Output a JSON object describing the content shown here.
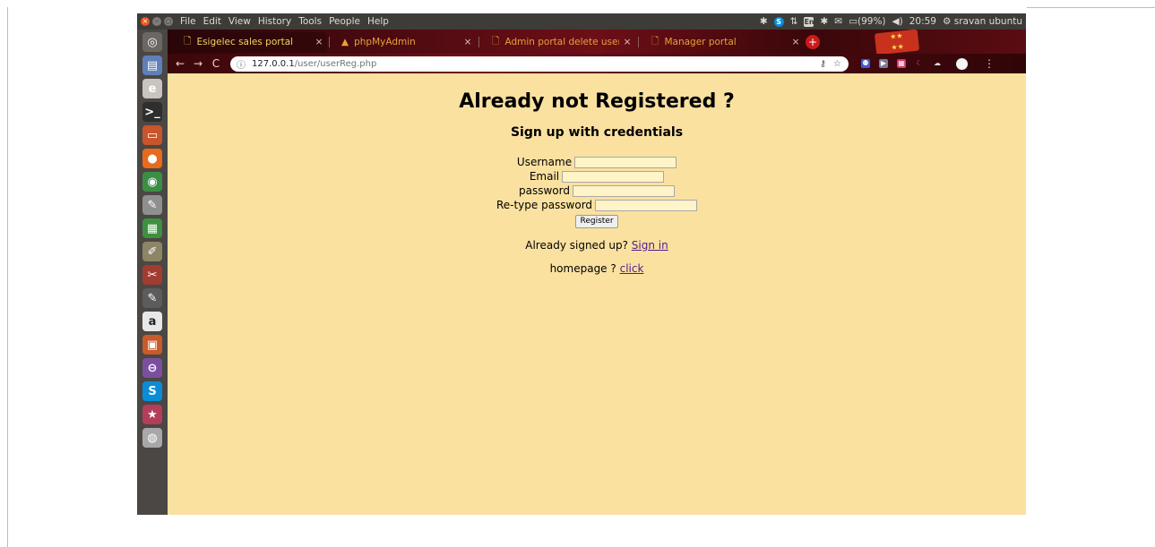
{
  "top_panel": {
    "menu": [
      "File",
      "Edit",
      "View",
      "History",
      "Tools",
      "People",
      "Help"
    ],
    "indicators": {
      "skype": "S",
      "keyboard_layout": "En",
      "battery": "(99%)",
      "time": "20:59",
      "user": "sravan ubuntu"
    }
  },
  "launcher": {
    "icons": [
      {
        "name": "dash-icon",
        "glyph": "◎",
        "color": "#6b6864"
      },
      {
        "name": "files-icon",
        "glyph": "▤",
        "color": "#5f7fb8"
      },
      {
        "name": "eclipse-icon",
        "glyph": "e",
        "color": "#c9c4be"
      },
      {
        "name": "terminal-icon",
        "glyph": ">_",
        "color": "#2e2e2e"
      },
      {
        "name": "archive-icon",
        "glyph": "▭",
        "color": "#c9552c"
      },
      {
        "name": "firefox-icon",
        "glyph": "●",
        "color": "#e86a1d"
      },
      {
        "name": "chrome-icon",
        "glyph": "◉",
        "color": "#3c8e45"
      },
      {
        "name": "text-editor-icon",
        "glyph": "✎",
        "color": "#8f8f8f"
      },
      {
        "name": "spreadsheet-icon",
        "glyph": "▦",
        "color": "#3d9140"
      },
      {
        "name": "draw-icon",
        "glyph": "✐",
        "color": "#8c8566"
      },
      {
        "name": "settings-tool-icon",
        "glyph": "✂",
        "color": "#a23c30"
      },
      {
        "name": "notes-icon",
        "glyph": "✎",
        "color": "#5c5c5c"
      },
      {
        "name": "amazon-icon",
        "glyph": "a",
        "color": "#e8e8e8"
      },
      {
        "name": "software-center-icon",
        "glyph": "▣",
        "color": "#c75b2a"
      },
      {
        "name": "disk-icon",
        "glyph": "⊖",
        "color": "#7b4fa0"
      },
      {
        "name": "skype-icon",
        "glyph": "S",
        "color": "#0a8dd6"
      },
      {
        "name": "starred-app-icon",
        "glyph": "★",
        "color": "#b33d5a"
      },
      {
        "name": "optical-drive-icon",
        "glyph": "◍",
        "color": "#a8a8a8"
      }
    ]
  },
  "tabs": [
    {
      "title": "Esigelec sales portal",
      "icon": "page-icon",
      "active": true
    },
    {
      "title": "phpMyAdmin",
      "icon": "phpmyadmin-icon",
      "active": false
    },
    {
      "title": "Admin portal delete users",
      "icon": "page-icon",
      "active": false
    },
    {
      "title": "Manager portal",
      "icon": "page-icon",
      "active": false
    }
  ],
  "toolbar": {
    "url_host": "127.0.0.1",
    "url_path": "/user/userReg.php"
  },
  "page": {
    "title": "Already not Registered ?",
    "subtitle": "Sign up with credentials",
    "fields": {
      "username_label": "Username",
      "email_label": "Email",
      "password_label": "password",
      "retype_label": "Re-type password"
    },
    "register_label": "Register",
    "signin_prompt": "Already signed up?",
    "signin_link": "Sign in",
    "homepage_prompt": "homepage ?",
    "homepage_link": "click"
  }
}
